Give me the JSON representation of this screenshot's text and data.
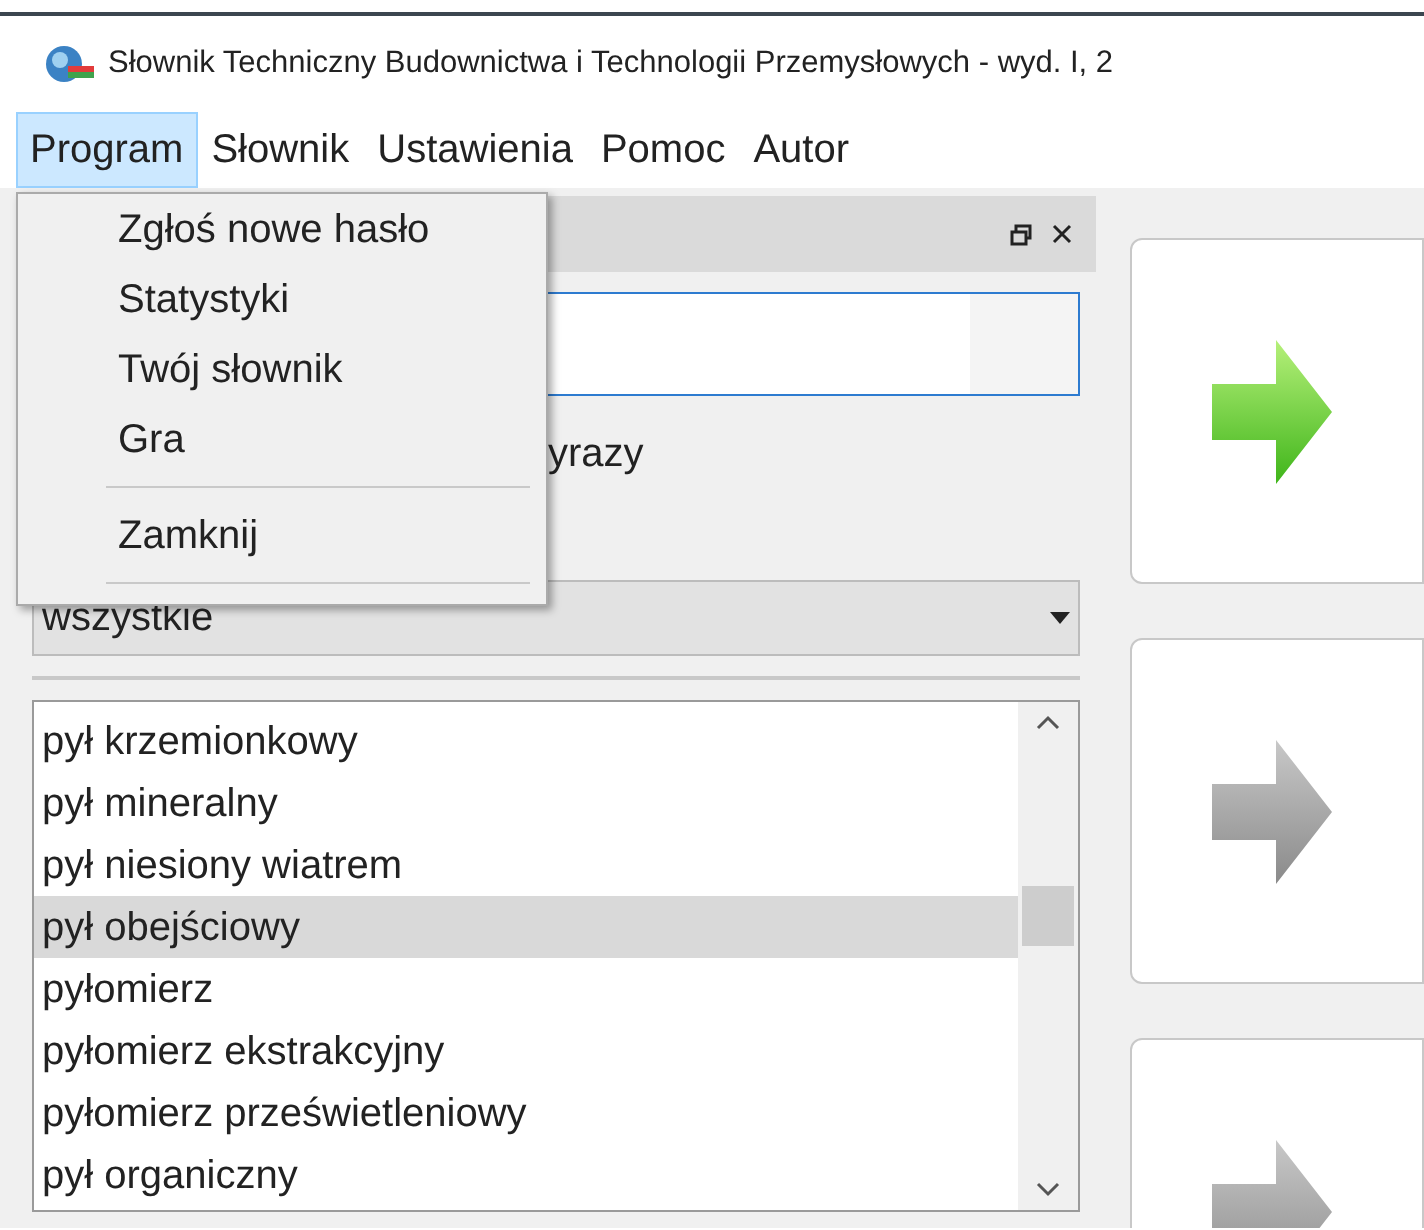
{
  "window": {
    "title": "Słownik Techniczny Budownictwa i Technologii Przemysłowych - wyd. I, 2"
  },
  "menu_bar": [
    {
      "label": "Program",
      "selected": true
    },
    {
      "label": "Słownik",
      "selected": false
    },
    {
      "label": "Ustawienia",
      "selected": false
    },
    {
      "label": "Pomoc",
      "selected": false
    },
    {
      "label": "Autor",
      "selected": false
    }
  ],
  "open_menu": [
    {
      "kind": "item",
      "label": "Zgłoś nowe hasło"
    },
    {
      "kind": "item",
      "label": "Statystyki"
    },
    {
      "kind": "item",
      "label": "Twój słownik"
    },
    {
      "kind": "item",
      "label": "Gra"
    },
    {
      "kind": "separator"
    },
    {
      "kind": "item",
      "label": "Zamknij"
    },
    {
      "kind": "separator"
    }
  ],
  "search_panel": {
    "checkbox_label": "yrazy",
    "filter": "wszystkie",
    "terms": [
      {
        "label": "pył krzemionkowy",
        "selected": false
      },
      {
        "label": "pył mineralny",
        "selected": false
      },
      {
        "label": "pył niesiony wiatrem",
        "selected": false
      },
      {
        "label": "pył obejściowy",
        "selected": true
      },
      {
        "label": "pyłomierz",
        "selected": false
      },
      {
        "label": "pyłomierz ekstrakcyjny",
        "selected": false
      },
      {
        "label": "pyłomierz prześwietleniowy",
        "selected": false
      },
      {
        "label": "pył organiczny",
        "selected": false
      }
    ]
  },
  "arrow_buttons": [
    {
      "highlighted": true
    },
    {
      "highlighted": false
    },
    {
      "highlighted": false
    }
  ]
}
